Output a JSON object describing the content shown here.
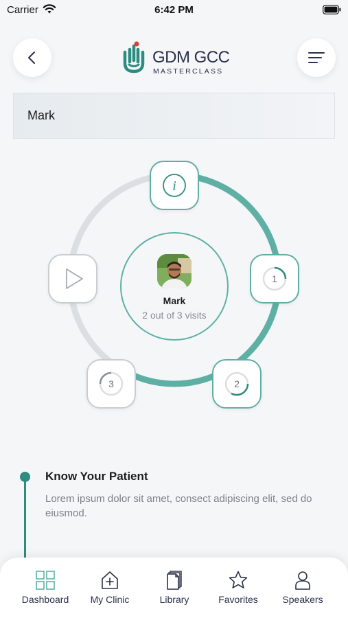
{
  "status_bar": {
    "carrier": "Carrier",
    "time": "6:42 PM"
  },
  "header": {
    "logo_title": "GDM GCC",
    "logo_subtitle": "MASTERCLASS",
    "back_icon": "chevron-left-icon",
    "menu_icon": "hamburger-menu-icon"
  },
  "patient_bar": {
    "name": "Mark"
  },
  "visit_diagram": {
    "patient_name": "Mark",
    "visits_text": "2 out of 3 visits",
    "visits_completed": 2,
    "visits_total": 3,
    "nodes": [
      {
        "id": "info",
        "icon": "info-icon",
        "state": "active"
      },
      {
        "id": "step-1",
        "label": "1",
        "state": "active",
        "progress": 0.25
      },
      {
        "id": "step-2",
        "label": "2",
        "state": "active",
        "progress": 0.4
      },
      {
        "id": "step-3",
        "label": "3",
        "state": "inactive",
        "progress": 0.35
      },
      {
        "id": "play",
        "icon": "play-icon",
        "state": "inactive"
      }
    ],
    "colors": {
      "accent": "#5fb0a4",
      "inactive": "#dcdfe2"
    }
  },
  "timeline": {
    "title": "Know Your Patient",
    "body": "Lorem ipsum dolor sit amet, consect adipiscing elit, sed do eiusmod."
  },
  "tab_bar": {
    "items": [
      {
        "label": "Dashboard",
        "icon": "dashboard-icon",
        "active": true
      },
      {
        "label": "My Clinic",
        "icon": "clinic-icon",
        "active": false
      },
      {
        "label": "Library",
        "icon": "library-icon",
        "active": false
      },
      {
        "label": "Favorites",
        "icon": "star-icon",
        "active": false
      },
      {
        "label": "Speakers",
        "icon": "person-icon",
        "active": false
      }
    ]
  }
}
